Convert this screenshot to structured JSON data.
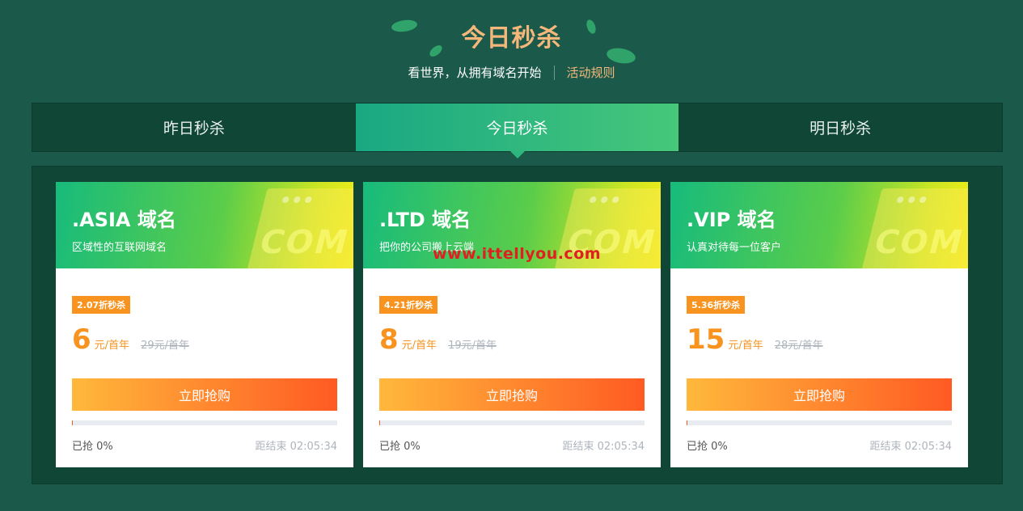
{
  "header": {
    "title": "今日秒杀",
    "subtitle": "看世界，从拥有域名开始",
    "rules_link": "活动规则"
  },
  "tabs": [
    {
      "label": "昨日秒杀",
      "active": false
    },
    {
      "label": "今日秒杀",
      "active": true
    },
    {
      "label": "明日秒杀",
      "active": false
    }
  ],
  "cards": [
    {
      "title": ".ASIA 域名",
      "desc": "区域性的互联网域名",
      "deco_text": "COM",
      "badge": "2.07折秒杀",
      "price": "6",
      "unit": "元/首年",
      "original": "29元/首年",
      "buy_label": "立即抢购",
      "progress_percent": 0,
      "sold": "已抢 0%",
      "countdown": "距结束 02:05:34"
    },
    {
      "title": ".LTD 域名",
      "desc": "把你的公司搬上云端",
      "deco_text": "COM",
      "badge": "4.21折秒杀",
      "price": "8",
      "unit": "元/首年",
      "original": "19元/首年",
      "buy_label": "立即抢购",
      "progress_percent": 0,
      "sold": "已抢 0%",
      "countdown": "距结束 02:05:34"
    },
    {
      "title": ".VIP 域名",
      "desc": "认真对待每一位客户",
      "deco_text": "COM",
      "badge": "5.36折秒杀",
      "price": "15",
      "unit": "元/首年",
      "original": "28元/首年",
      "buy_label": "立即抢购",
      "progress_percent": 0,
      "sold": "已抢 0%",
      "countdown": "距结束 02:05:34"
    }
  ],
  "watermark": "www.ittellyou.com",
  "colors": {
    "background": "#1b5a4a",
    "accent_orange": "#f7931e",
    "title_gold": "#f5b77a",
    "button_start": "#ffb83b",
    "button_end": "#ff5a23"
  }
}
